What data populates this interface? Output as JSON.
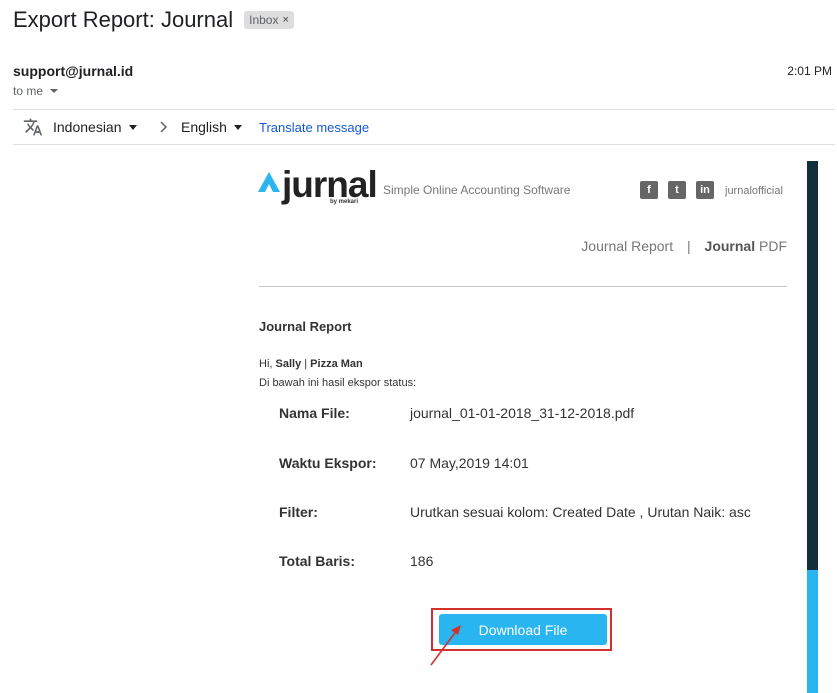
{
  "email": {
    "subject": "Export Report: Journal",
    "label": "Inbox",
    "sender": "support@jurnal.id",
    "recipient": "to me",
    "time": "2:01 PM"
  },
  "translate": {
    "from_language": "Indonesian",
    "to_language": "English",
    "link_label": "Translate message",
    "icon": "translate-icon"
  },
  "content": {
    "brand": "jurnal",
    "brand_sub": "by mekari",
    "tagline": "Simple Online Accounting Software",
    "social": {
      "facebook": "f",
      "twitter": "t",
      "linkedin": "in",
      "handle": "jurnalofficial"
    },
    "report_link_1": "Journal Report",
    "report_link_sep": "|",
    "report_link_2_bold": "Journal",
    "report_link_2_rest": " PDF",
    "title": "Journal Report",
    "greet_prefix": "Hi, ",
    "greet_name": "Sally",
    "greet_sep": " | ",
    "greet_company": "Pizza Man",
    "description": "Di bawah ini hasil ekspor status:",
    "fields": [
      {
        "label": "Nama File:",
        "value": "journal_01-01-2018_31-12-2018.pdf"
      },
      {
        "label": "Waktu Ekspor:",
        "value": "07 May,2019 14:01"
      },
      {
        "label": "Filter:",
        "value": "Urutkan sesuai kolom: Created Date , Urutan Naik: asc"
      },
      {
        "label": "Total Baris:",
        "value": "186"
      }
    ],
    "download_label": "Download File"
  },
  "colors": {
    "accent": "#29b6f0",
    "highlight": "#d32f2f",
    "sidebar_dark": "#12303c"
  }
}
